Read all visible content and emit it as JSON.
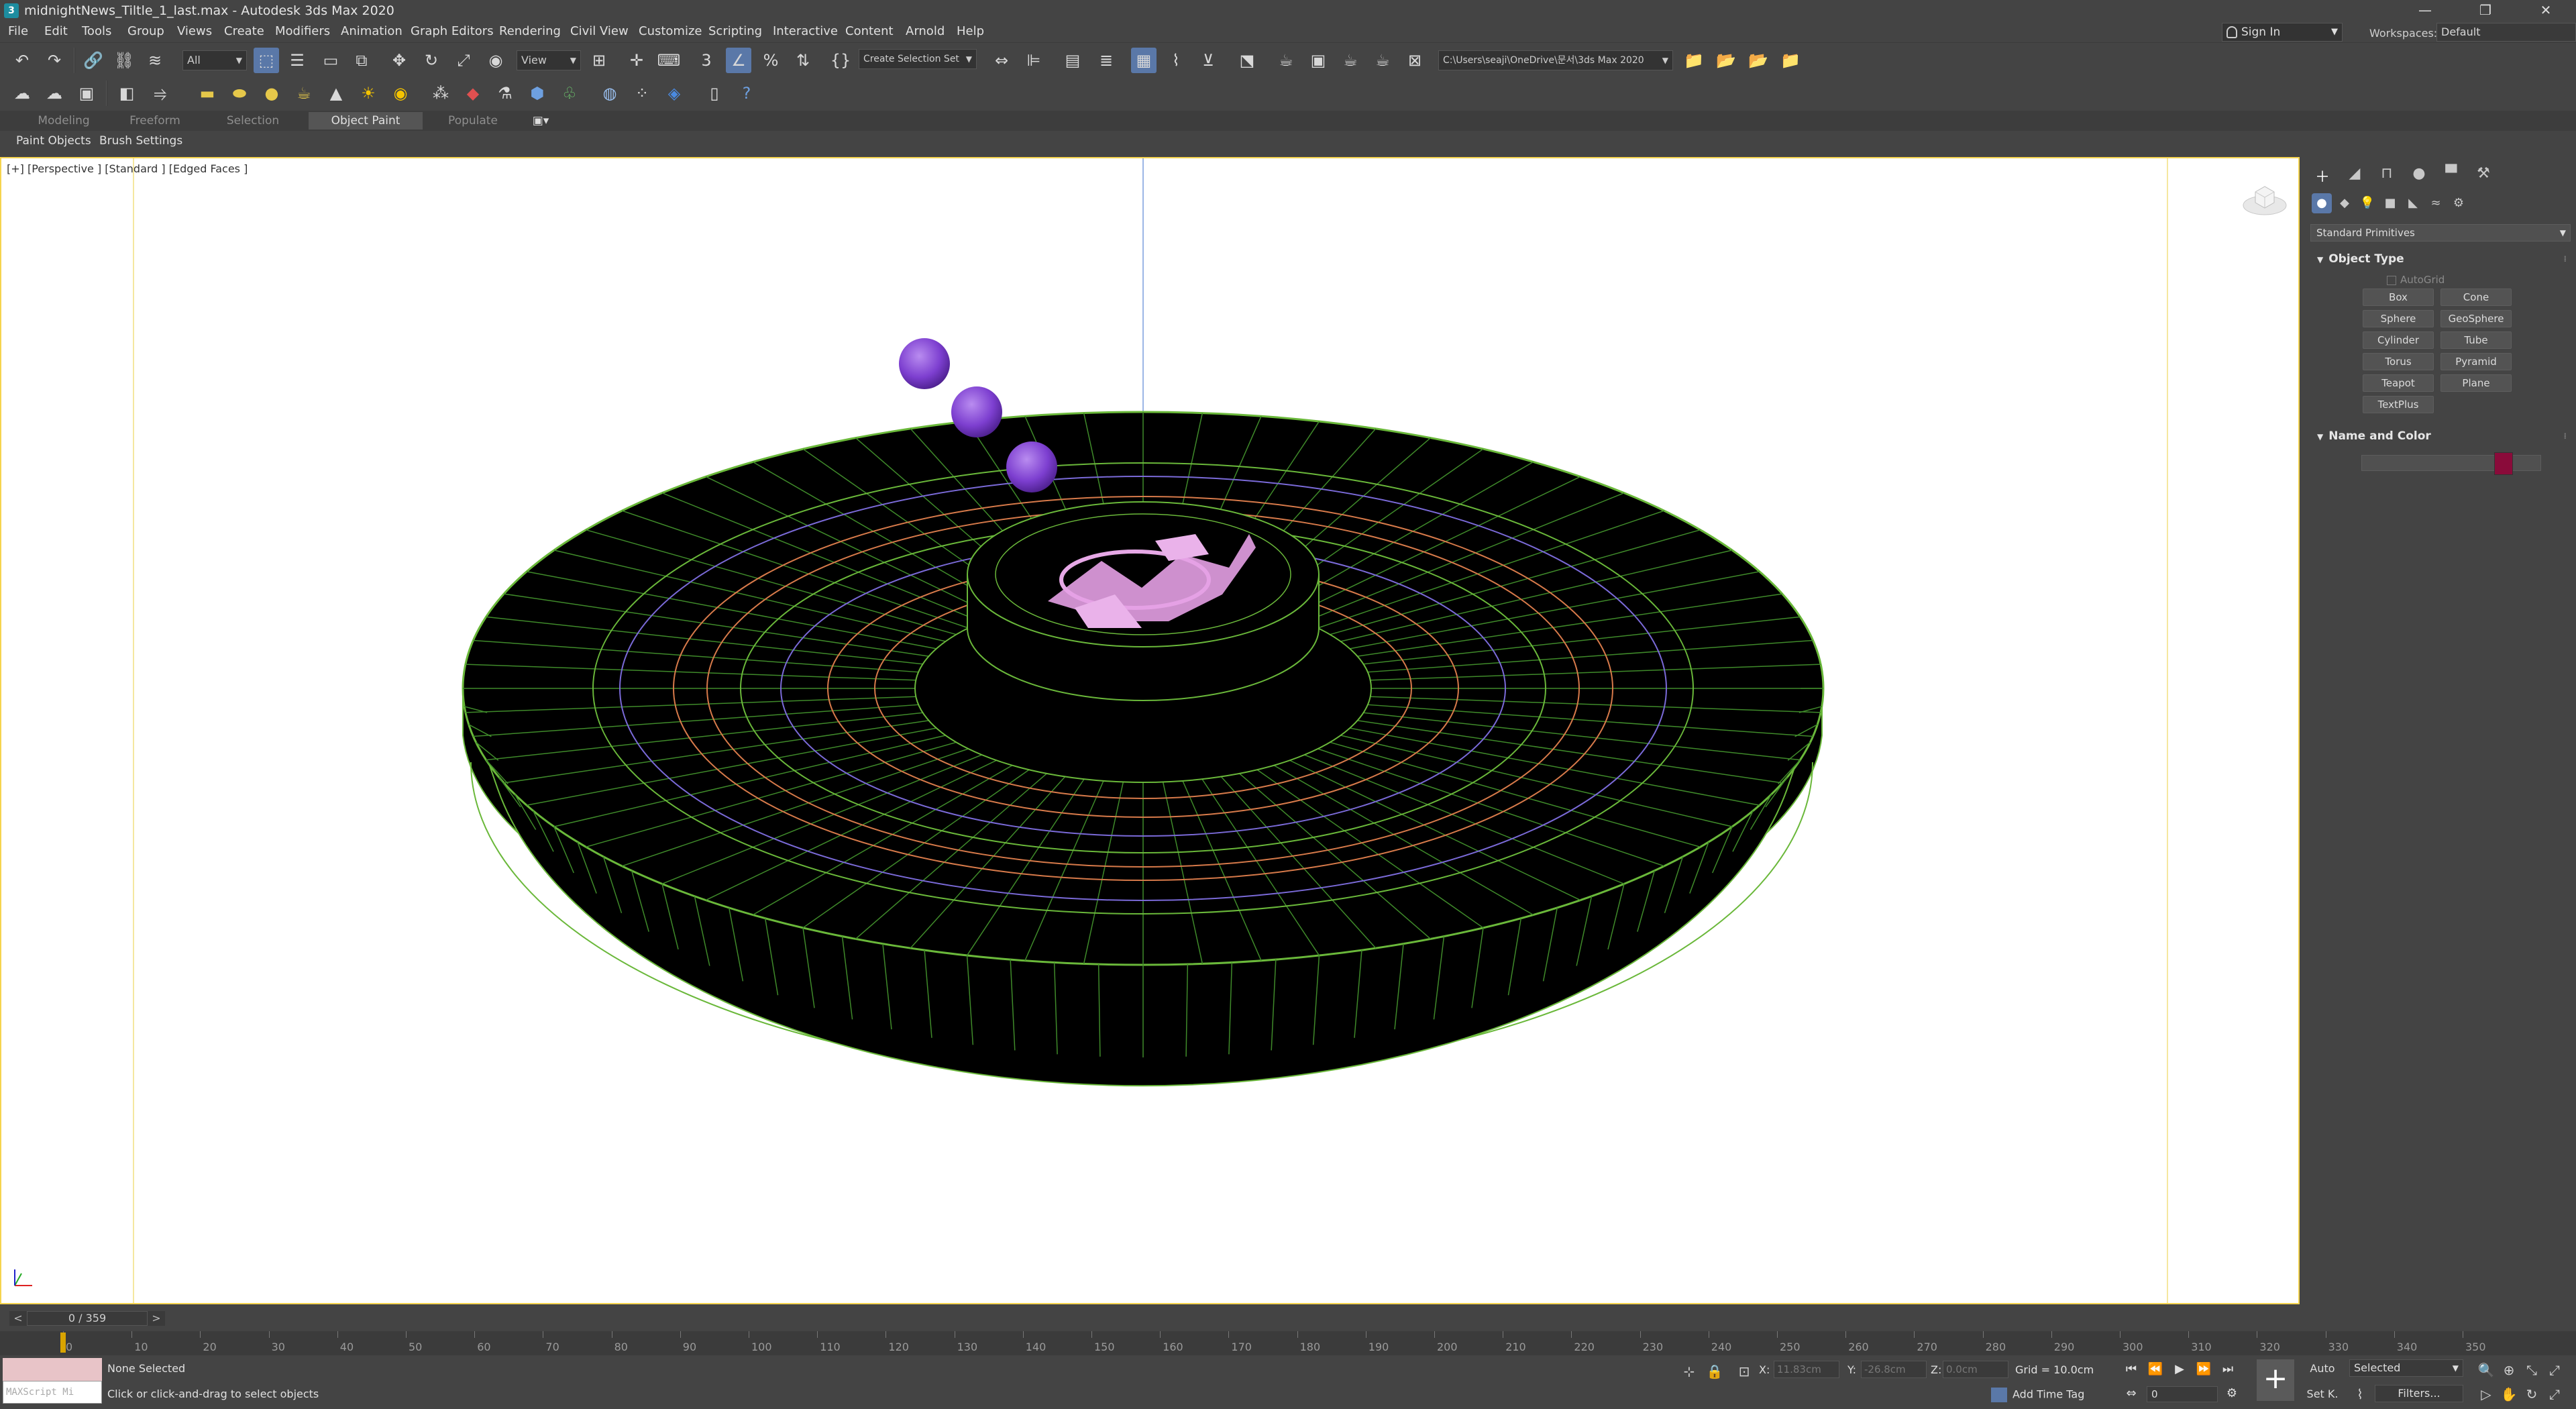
{
  "window": {
    "title": "midnightNews_Tiltle_1_last.max - Autodesk 3ds Max 2020",
    "app_icon": "3",
    "controls": [
      "—",
      "❐",
      "✕"
    ]
  },
  "menu": [
    "File",
    "Edit",
    "Tools",
    "Group",
    "Views",
    "Create",
    "Modifiers",
    "Animation",
    "Graph Editors",
    "Rendering",
    "Civil View",
    "Customize",
    "Scripting",
    "Interactive",
    "Content",
    "Arnold",
    "Help"
  ],
  "account": {
    "sign_in": "Sign In",
    "workspaces_label": "Workspaces:",
    "workspace": "Default"
  },
  "toolbar": {
    "filter": "All",
    "ref_coord": "View",
    "selection_set": "Create Selection Set",
    "project_path": "C:\\Users\\seaji\\OneDrive\\문서\\3ds Max 2020"
  },
  "ribbon": {
    "tabs": [
      "Modeling",
      "Freeform",
      "Selection",
      "Object Paint",
      "Populate"
    ],
    "active_tab": "Object Paint",
    "panel_items": [
      "Paint Objects",
      "Brush Settings"
    ]
  },
  "viewport": {
    "label": "[+] [Perspective ] [Standard ] [Edged Faces ]"
  },
  "command_panel": {
    "category": "Standard Primitives",
    "object_type_title": "Object Type",
    "autogrid": "AutoGrid",
    "buttons": [
      "Box",
      "Cone",
      "Sphere",
      "GeoSphere",
      "Cylinder",
      "Tube",
      "Torus",
      "Pyramid",
      "Teapot",
      "Plane",
      "TextPlus"
    ],
    "name_color_title": "Name and Color",
    "object_color": "#8a0b3a"
  },
  "timeline": {
    "frame_display": "0 / 359",
    "prev": "<",
    "next": ">",
    "ticks": [
      "0",
      "10",
      "20",
      "30",
      "40",
      "50",
      "60",
      "70",
      "80",
      "90",
      "100",
      "110",
      "120",
      "130",
      "140",
      "150",
      "160",
      "170",
      "180",
      "190",
      "200",
      "210",
      "220",
      "230",
      "240",
      "250",
      "260",
      "270",
      "280",
      "290",
      "300",
      "310",
      "320",
      "330",
      "340",
      "350"
    ]
  },
  "status": {
    "maxscript_placeholder": "MAXScript Mi",
    "selection": "None Selected",
    "prompt": "Click or click-and-drag to select objects",
    "x_label": "X:",
    "x_value": "11.83cm",
    "y_label": "Y:",
    "y_value": "-26.8cm",
    "z_label": "Z:",
    "z_value": "0.0cm",
    "grid": "Grid = 10.0cm",
    "add_time_tag": "Add Time Tag",
    "auto": "Auto",
    "set_key": "Set K.",
    "selected": "Selected",
    "filters": "Filters...",
    "current_frame": "0"
  }
}
